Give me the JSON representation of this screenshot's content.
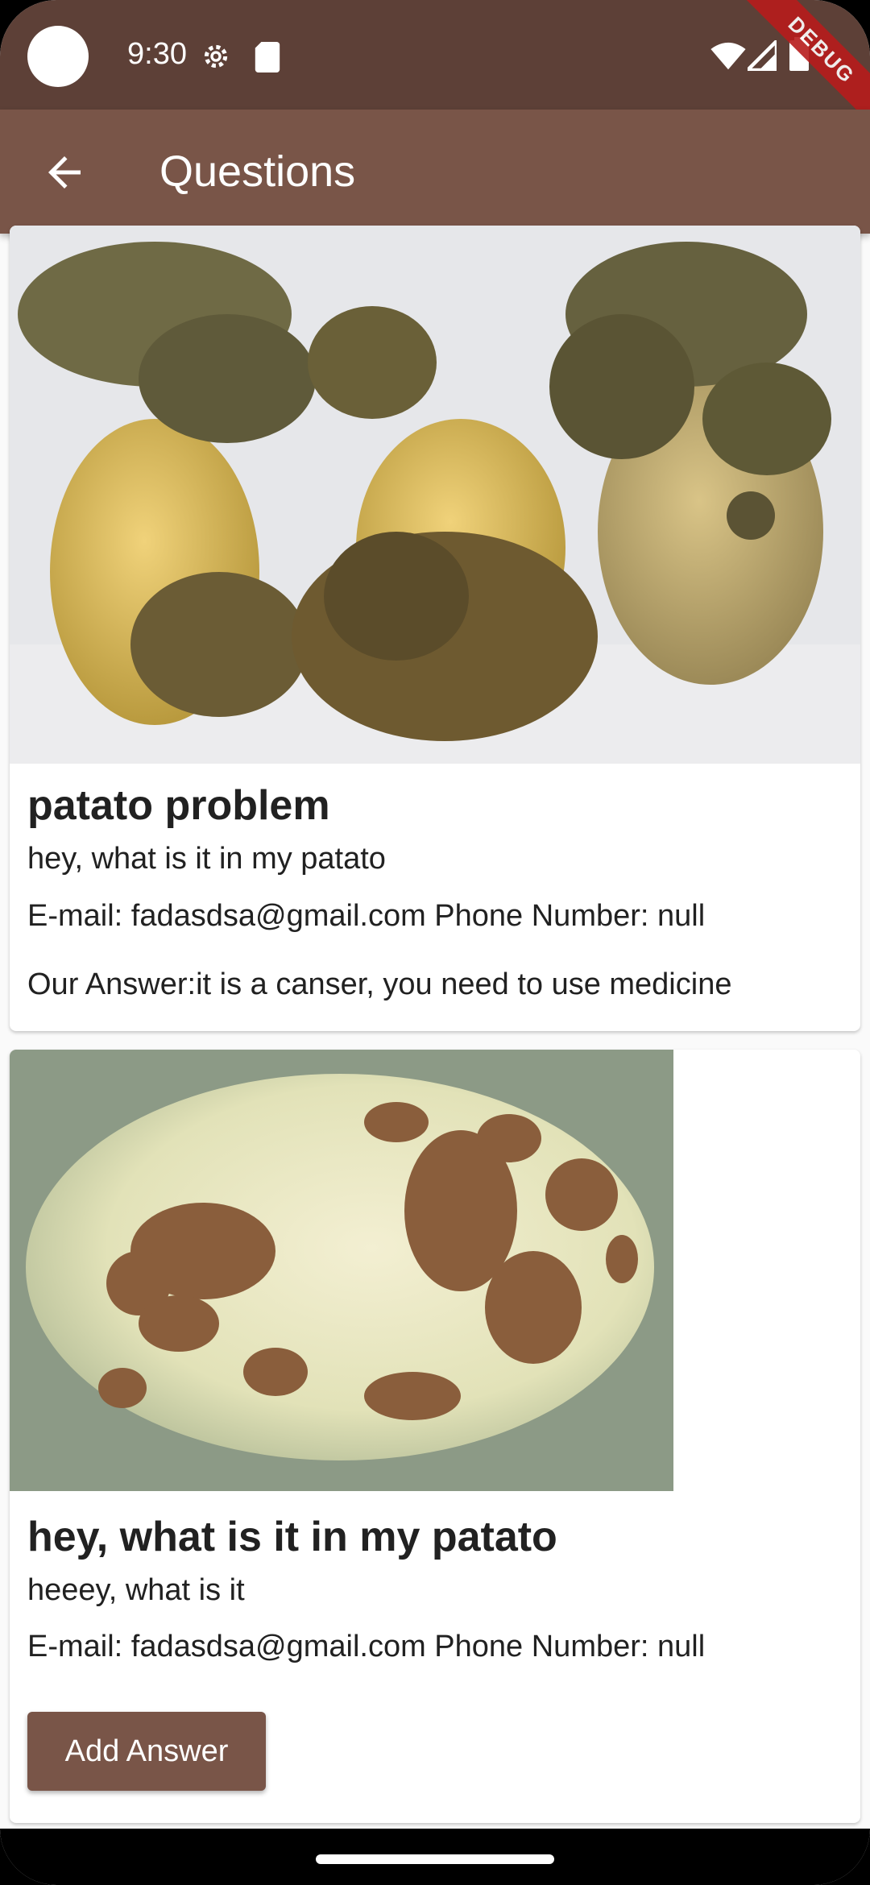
{
  "status_bar": {
    "time": "9:30",
    "debug_label": "DEBUG"
  },
  "app_bar": {
    "title": "Questions"
  },
  "questions": [
    {
      "title": "patato problem",
      "body": "hey, what is it in my patato",
      "contact": "E-mail: fadasdsa@gmail.com Phone Number: null",
      "answer": "Our Answer:it is a canser, you need to use medicine"
    },
    {
      "title": "hey, what is it in my patato",
      "body": "heeey, what is it",
      "contact": "E-mail: fadasdsa@gmail.com Phone Number: null",
      "button_label": "Add Answer"
    }
  ],
  "colors": {
    "status_bar": "#5d4037",
    "app_bar": "#795548",
    "button": "#795548"
  }
}
